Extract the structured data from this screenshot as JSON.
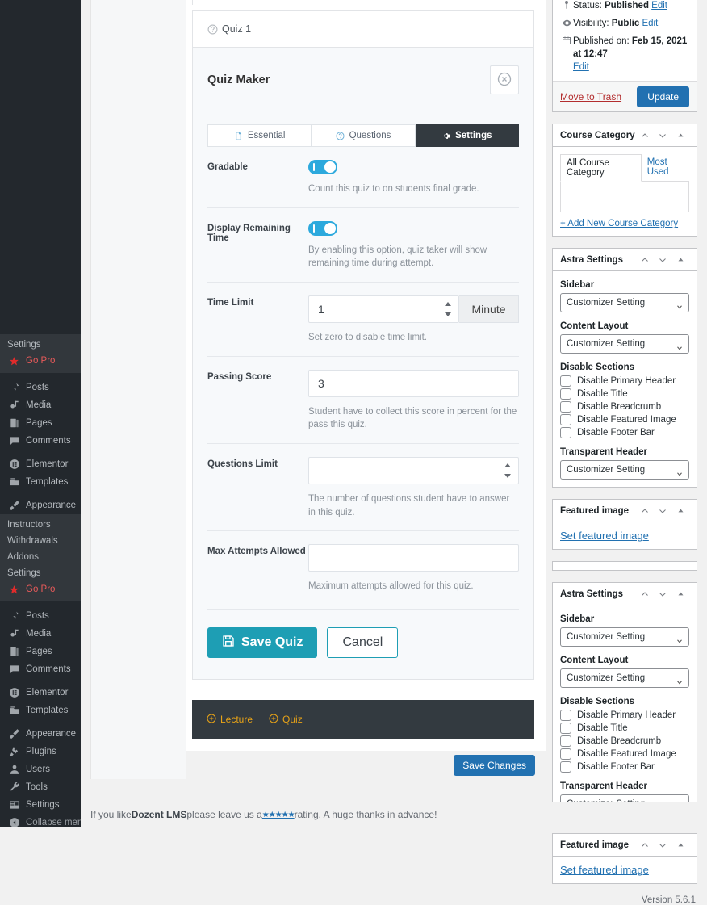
{
  "sidebar": {
    "group1_submenu": [
      {
        "label": "Settings",
        "icon": ""
      },
      {
        "label": "Go Pro",
        "icon": "star-icon",
        "pro": true
      }
    ],
    "group1": [
      {
        "label": "Posts",
        "icon": "pin-icon"
      },
      {
        "label": "Media",
        "icon": "media-icon"
      },
      {
        "label": "Pages",
        "icon": "pages-icon"
      },
      {
        "label": "Comments",
        "icon": "comments-icon"
      },
      {
        "label": "Elementor",
        "icon": "elementor-icon"
      },
      {
        "label": "Templates",
        "icon": "templates-icon"
      },
      {
        "label": "Appearance",
        "icon": "appearance-icon"
      }
    ],
    "group2_submenu": [
      {
        "label": "Instructors",
        "icon": ""
      },
      {
        "label": "Withdrawals",
        "icon": ""
      },
      {
        "label": "Addons",
        "icon": ""
      },
      {
        "label": "Settings",
        "icon": ""
      },
      {
        "label": "Go Pro",
        "icon": "star-icon",
        "pro": true
      }
    ],
    "group2": [
      {
        "label": "Posts",
        "icon": "pin-icon"
      },
      {
        "label": "Media",
        "icon": "media-icon"
      },
      {
        "label": "Pages",
        "icon": "pages-icon"
      },
      {
        "label": "Comments",
        "icon": "comments-icon"
      },
      {
        "label": "Elementor",
        "icon": "elementor-icon"
      },
      {
        "label": "Templates",
        "icon": "templates-icon"
      },
      {
        "label": "Appearance",
        "icon": "appearance-icon"
      },
      {
        "label": "Plugins",
        "icon": "plugins-icon"
      },
      {
        "label": "Users",
        "icon": "users-icon"
      },
      {
        "label": "Tools",
        "icon": "tools-icon"
      },
      {
        "label": "Settings",
        "icon": "settings-icon"
      },
      {
        "label": "Collapse menu",
        "icon": "collapse-icon"
      }
    ]
  },
  "quiz": {
    "item_title": "Quiz 1",
    "maker_title": "Quiz Maker",
    "tabs": [
      {
        "label": "Essential",
        "icon": "document-icon",
        "active": false
      },
      {
        "label": "Questions",
        "icon": "question-circle-icon",
        "active": false
      },
      {
        "label": "Settings",
        "icon": "gear-icon",
        "active": true
      }
    ],
    "fields": {
      "gradable": {
        "label": "Gradable",
        "help": "Count this quiz to on students final grade.",
        "on": true
      },
      "display_remaining_time": {
        "label": "Display Remaining Time",
        "help": "By enabling this option, quiz taker will show remaining time during attempt.",
        "on": true
      },
      "time_limit": {
        "label": "Time Limit",
        "value": "1",
        "unit": "Minute",
        "help": "Set zero to disable time limit."
      },
      "passing_score": {
        "label": "Passing Score",
        "value": "3",
        "help": "Student have to collect this score in percent for the pass this quiz."
      },
      "questions_limit": {
        "label": "Questions Limit",
        "value": "",
        "placeholder": "",
        "help": "The number of questions student have to answer in this quiz."
      },
      "max_attempts": {
        "label": "Max Attempts Allowed",
        "value": "",
        "placeholder": "",
        "help": "Maximum attempts allowed for this quiz."
      }
    },
    "save_label": "Save Quiz",
    "cancel_label": "Cancel",
    "add_lecture_label": "Lecture",
    "add_quiz_label": "Quiz",
    "save_changes_label": "Save Changes"
  },
  "publish": {
    "status_prefix": "Status:",
    "status_value": "Published",
    "status_edit": "Edit",
    "visibility_prefix": "Visibility:",
    "visibility_value": "Public",
    "visibility_edit": "Edit",
    "published_prefix": "Published on:",
    "published_value": "Feb 15, 2021 at 12:47",
    "published_edit": "Edit",
    "trash_label": "Move to Trash",
    "update_label": "Update"
  },
  "course_category": {
    "title": "Course Category",
    "tab_all": "All Course Category",
    "tab_most_used": "Most Used",
    "add_new": "+ Add New Course Category"
  },
  "astra": {
    "title": "Astra Settings",
    "sidebar_label": "Sidebar",
    "sidebar_value": "Customizer Setting",
    "content_layout_label": "Content Layout",
    "content_layout_value": "Customizer Setting",
    "disable_sections_label": "Disable Sections",
    "disable_sections": [
      "Disable Primary Header",
      "Disable Title",
      "Disable Breadcrumb",
      "Disable Featured Image",
      "Disable Footer Bar"
    ],
    "transparent_header_label": "Transparent Header",
    "transparent_header_value": "Customizer Setting"
  },
  "featured_image": {
    "title": "Featured image",
    "set_link": "Set featured image"
  },
  "version": "Version 5.6.1",
  "footer": {
    "pre": "If you like ",
    "brand": "Dozent LMS",
    "mid": " please leave us a ",
    "stars": "★★★★★",
    "post": " rating. A huge thanks in advance!"
  },
  "colors": {
    "accent_teal": "#1e9eb4",
    "toggle_blue": "#2ca9dd",
    "wp_blue": "#2271b1",
    "dark_tab": "#333a40",
    "orange": "#e8a317",
    "pro_red": "#e02b2b"
  }
}
